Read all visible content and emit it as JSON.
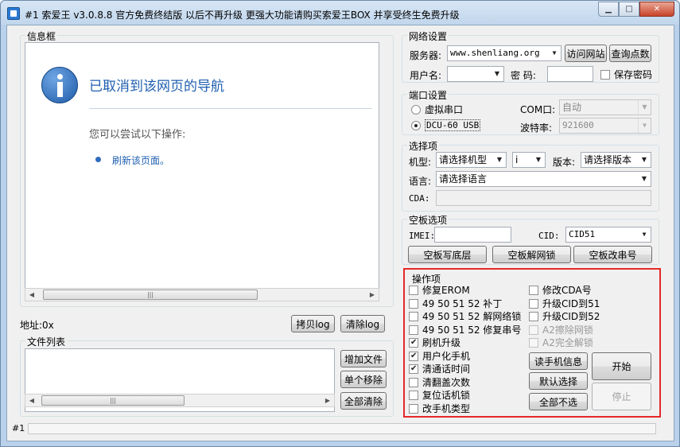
{
  "window": {
    "title": "#1 索爱王 v3.0.8.8  官方免费终结版  以后不再升级  更强大功能请购买索爱王BOX  并享受终生免费升级",
    "min_label": "▁",
    "max_label": "□",
    "close_label": "✕"
  },
  "info": {
    "group_title": "信息框",
    "heading": "已取消到该网页的导航",
    "hint": "您可以尝试以下操作:",
    "link": "刷新该页面。",
    "accent_color": "#1f5fb0"
  },
  "address": {
    "label": "地址:0x",
    "copy_log": "拷贝log",
    "clear_log": "清除log"
  },
  "files": {
    "group_title": "文件列表",
    "add": "增加文件",
    "remove_one": "单个移除",
    "remove_all": "全部清除"
  },
  "network": {
    "group_title": "网络设置",
    "server_label": "服务器:",
    "server_value": "www.shenliang.org",
    "visit_site": "访问网站",
    "query_points": "查询点数",
    "user_label": "用户名:",
    "user_value": "",
    "password_label": "密  码:",
    "password_value": "",
    "save_password": "保存密码"
  },
  "port": {
    "group_title": "端口设置",
    "virtual_serial": "虚拟串口",
    "dcu_usb": "DCU-60 USB",
    "com_label": "COM口:",
    "com_value": "自动",
    "baud_label": "波特率:",
    "baud_value": "921600"
  },
  "options": {
    "group_title": "选择项",
    "model_label": "机型:",
    "model_value": "请选择机型",
    "sub_value": "i",
    "version_label": "版本:",
    "version_value": "请选择版本",
    "language_label": "语言:",
    "language_value": "请选择语言",
    "cda_label": "CDA:",
    "cda_value": ""
  },
  "blank": {
    "group_title": "空板选项",
    "imei_label": "IMEI:",
    "imei_value": "",
    "cid_label": "CID:",
    "cid_value": "CID51",
    "btn_write": "空板写底层",
    "btn_unlock": "空板解网锁",
    "btn_serial": "空板改串号"
  },
  "ops": {
    "group_title": "操作项",
    "left": [
      {
        "label": "修复EROM",
        "checked": false
      },
      {
        "label": "49 50 51 52 补丁",
        "checked": false
      },
      {
        "label": "49 50 51 52 解网络锁",
        "checked": false
      },
      {
        "label": "49 50 51 52 修复串号",
        "checked": false
      },
      {
        "label": "刷机升级",
        "checked": true
      },
      {
        "label": "用户化手机",
        "checked": true
      },
      {
        "label": "清通话时间",
        "checked": true
      },
      {
        "label": "清翻盖次数",
        "checked": false
      },
      {
        "label": "复位话机锁",
        "checked": false
      },
      {
        "label": "改手机类型",
        "checked": false
      }
    ],
    "right": [
      {
        "label": "修改CDA号",
        "checked": false,
        "disabled": false
      },
      {
        "label": "升级CID到51",
        "checked": false,
        "disabled": false
      },
      {
        "label": "升级CID到52",
        "checked": false,
        "disabled": false
      },
      {
        "label": "A2擦除网锁",
        "checked": false,
        "disabled": true
      },
      {
        "label": "A2完全解锁",
        "checked": false,
        "disabled": true
      }
    ],
    "read_info": "读手机信息",
    "default_select": "默认选择",
    "select_none": "全部不选",
    "start": "开始",
    "stop": "停止",
    "highlight_color": "#e52828"
  },
  "status": {
    "id": "#1"
  }
}
